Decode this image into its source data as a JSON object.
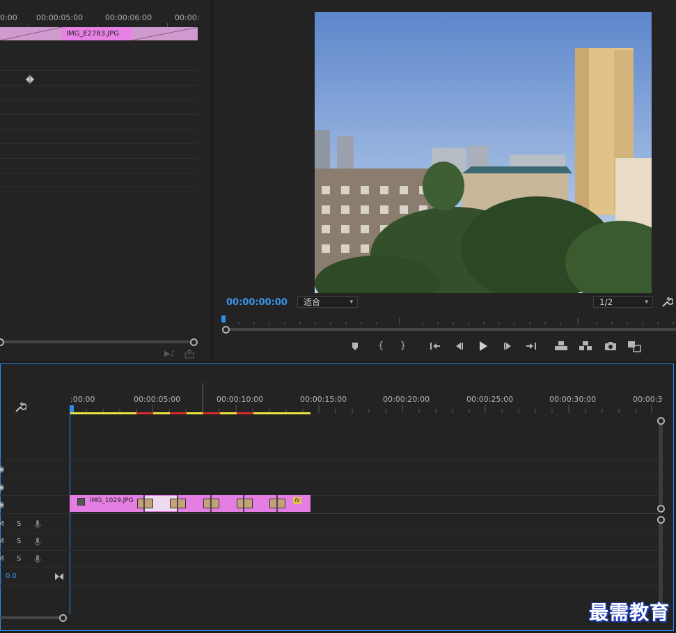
{
  "effect_controls": {
    "ruler_labels": [
      "0:00",
      "00:00:05:00",
      "00:00:06:00",
      "00:00:"
    ],
    "clip_name": "IMG_E2783.JPG"
  },
  "program_monitor": {
    "timecode": "00:00:00:00",
    "zoom_select": "适合",
    "resolution_select": "1/2",
    "controls": [
      "add-marker",
      "mark-in",
      "mark-out",
      "go-to-in",
      "step-back",
      "play",
      "step-forward",
      "go-to-out",
      "lift",
      "extract",
      "export-frame",
      "compare"
    ]
  },
  "timeline": {
    "ruler_labels": [
      ":00:00",
      "00:00:05:00",
      "00:00:10:00",
      "00:00:15:00",
      "00:00:20:00",
      "00:00:25:00",
      "00:00:30:00",
      "00:00:3"
    ],
    "clip_name": "IMG_1029.JPG",
    "audio_tracks": [
      {
        "m": "M",
        "s": "S"
      },
      {
        "m": "M",
        "s": "S"
      },
      {
        "m": "M",
        "s": "S"
      }
    ],
    "master_value": "0.0",
    "fx_badge": "fx"
  },
  "watermark": "最需教育",
  "colors": {
    "accent_blue": "#2d8ceb",
    "clip_pink": "#e57ee2",
    "work_area_yellow": "#e8e03c",
    "render_red": "#d42b2b"
  }
}
